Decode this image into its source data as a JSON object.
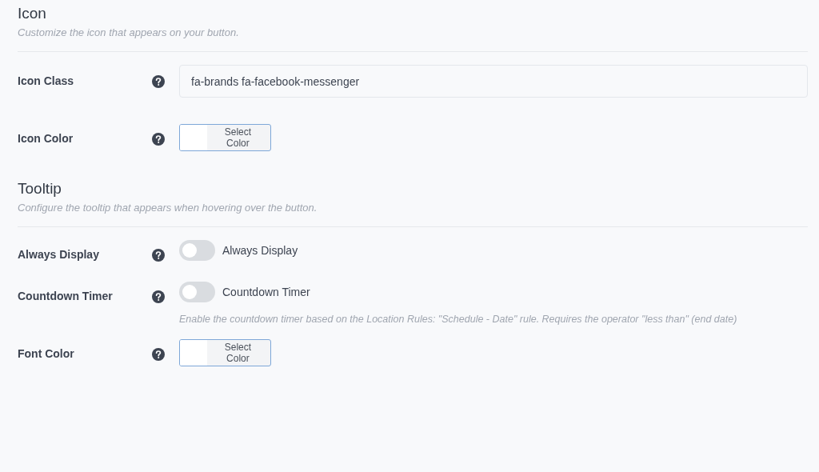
{
  "sections": [
    {
      "title": "Icon",
      "description": "Customize the icon that appears on your button.",
      "fields": [
        {
          "kind": "text",
          "label": "Icon Class",
          "value": "fa-brands fa-facebook-messenger"
        },
        {
          "kind": "color",
          "label": "Icon Color",
          "button": "Select Color"
        }
      ]
    },
    {
      "title": "Tooltip",
      "description": "Configure the tooltip that appears when hovering over the button.",
      "fields": [
        {
          "kind": "toggle",
          "label": "Always Display",
          "on": false,
          "text": "Always Display"
        },
        {
          "kind": "toggle",
          "label": "Countdown Timer",
          "on": false,
          "text": "Countdown Timer",
          "help": "Enable the countdown timer based on the Location Rules: \"Schedule - Date\" rule. Requires the operator \"less than\" (end date)"
        },
        {
          "kind": "color",
          "label": "Font Color",
          "button": "Select Color"
        }
      ]
    }
  ]
}
